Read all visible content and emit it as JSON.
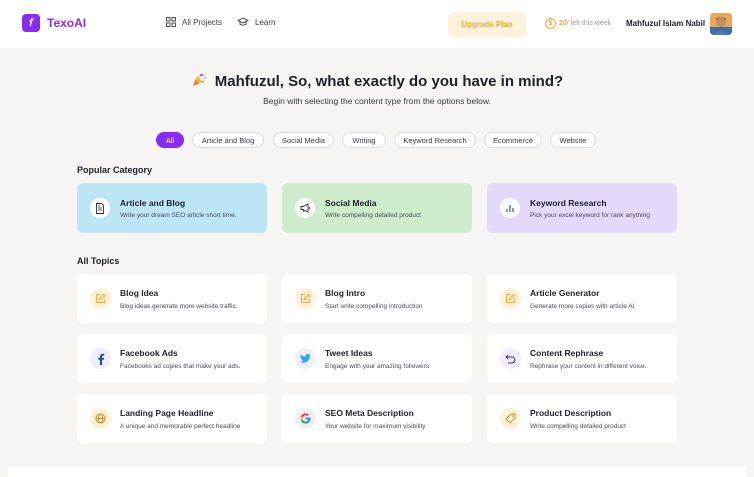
{
  "app": {
    "name": "TexoAI"
  },
  "nav": {
    "projects": "All Projects",
    "learn": "Learn"
  },
  "header": {
    "upgrade": "Upgrade Plan",
    "credits_count": "20",
    "credits_suffix": "/ left this week",
    "user_name": "Mahfuzul Islam Nabil"
  },
  "hero": {
    "title": "Mahfuzul, So, what exactly do you have in mind?",
    "subtitle": "Begin with selecting the content type from the options below."
  },
  "filters": [
    "All",
    "Article and Blog",
    "Social Media",
    "Writing",
    "Keyword Research",
    "Ecommerce",
    "Website"
  ],
  "sections": {
    "popular": "Popular Category",
    "all_topics": "All Topics"
  },
  "popular": [
    {
      "title": "Article and Blog",
      "desc": "Write your dream SEO article short time.",
      "icon": "document-icon",
      "color": "#bce6f6"
    },
    {
      "title": "Social Media",
      "desc": "Write compelling detailed product",
      "icon": "megaphone-icon",
      "color": "#cdeccb"
    },
    {
      "title": "Keyword Research",
      "desc": "Pick your excel keyword for rank anything",
      "icon": "bar-chart-icon",
      "color": "#e4d9fb"
    }
  ],
  "topics": [
    {
      "title": "Blog Idea",
      "desc": "Blog ideas generate more website traffic.",
      "icon": "edit-icon"
    },
    {
      "title": "Blog Intro",
      "desc": "Start write compelling introduction",
      "icon": "edit-icon"
    },
    {
      "title": "Article Generator",
      "desc": "Generate more copies with article AI",
      "icon": "edit-icon"
    },
    {
      "title": "Facebook Ads",
      "desc": "Facebooks ad copies that make your ads.",
      "icon": "facebook-icon"
    },
    {
      "title": "Tweet Ideas",
      "desc": "Engage with your amazing followers",
      "icon": "twitter-icon"
    },
    {
      "title": "Content Rephrase",
      "desc": "Rephrase your content in different voice.",
      "icon": "undo-icon"
    },
    {
      "title": "Landing Page Headline",
      "desc": "A unique and memorable perfect headline",
      "icon": "globe-icon"
    },
    {
      "title": "SEO Meta Description",
      "desc": "Your website for maximum visibility",
      "icon": "google-icon"
    },
    {
      "title": "Product Description",
      "desc": "Write compelling detailed product",
      "icon": "tag-icon"
    }
  ],
  "colors": {
    "accent": "#8b2cf5",
    "upgrade_text": "#f1a92a",
    "upgrade_bg": "#fdf3dc"
  }
}
